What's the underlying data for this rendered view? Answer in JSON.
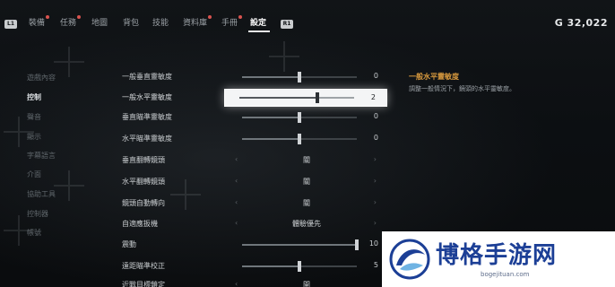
{
  "header": {
    "left_key": "L1",
    "right_key": "R1",
    "tabs": [
      {
        "label": "裝備",
        "alert": true
      },
      {
        "label": "任務",
        "alert": true
      },
      {
        "label": "地圖",
        "alert": false
      },
      {
        "label": "背包",
        "alert": false
      },
      {
        "label": "技能",
        "alert": false
      },
      {
        "label": "資料庫",
        "alert": true
      },
      {
        "label": "手冊",
        "alert": true
      },
      {
        "label": "設定",
        "alert": false,
        "active": true
      }
    ],
    "currency": "G  32,022"
  },
  "sidebar": {
    "items": [
      {
        "label": "遊戲內容"
      },
      {
        "label": "控制",
        "active": true
      },
      {
        "label": "聲音"
      },
      {
        "label": "顯示"
      },
      {
        "label": "字幕語言"
      },
      {
        "label": "介面"
      },
      {
        "label": "協助工具"
      },
      {
        "label": "控制器"
      },
      {
        "label": "帳號"
      }
    ]
  },
  "settings": {
    "rows": [
      {
        "label": "一般垂直靈敏度",
        "type": "slider",
        "value": "0",
        "level": 0.5
      },
      {
        "label": "一般水平靈敏度",
        "type": "slider",
        "value": "2",
        "level": 0.6,
        "selected": true
      },
      {
        "label": "垂直瞄準靈敏度",
        "type": "slider",
        "value": "0",
        "level": 0.5
      },
      {
        "label": "水平瞄準靈敏度",
        "type": "slider",
        "value": "0",
        "level": 0.5
      },
      {
        "label": "垂直翻轉鏡頭",
        "type": "choice",
        "value": "關"
      },
      {
        "label": "水平翻轉鏡頭",
        "type": "choice",
        "value": "關"
      },
      {
        "label": "鏡頭自動轉向",
        "type": "choice",
        "value": "關"
      },
      {
        "label": "自適應扳機",
        "type": "choice",
        "value": "體驗優先"
      },
      {
        "label": "震動",
        "type": "slider",
        "value": "10",
        "level": 1.0
      },
      {
        "label": "遠距瞄準校正",
        "type": "slider",
        "value": "5",
        "level": 0.5
      },
      {
        "label": "近戰目標鎖定",
        "type": "choice",
        "value": "開"
      }
    ]
  },
  "description": {
    "title": "一般水平靈敏度",
    "text": "調整一般情況下，鏡頭的水平靈敏度。"
  },
  "watermark": {
    "brand": "博格手游网",
    "url": "bogejituan.com"
  },
  "colors": {
    "accent_orange": "#d99a3e",
    "alert_dot": "#d9534f",
    "selected_bg": "#f4f5f6"
  }
}
